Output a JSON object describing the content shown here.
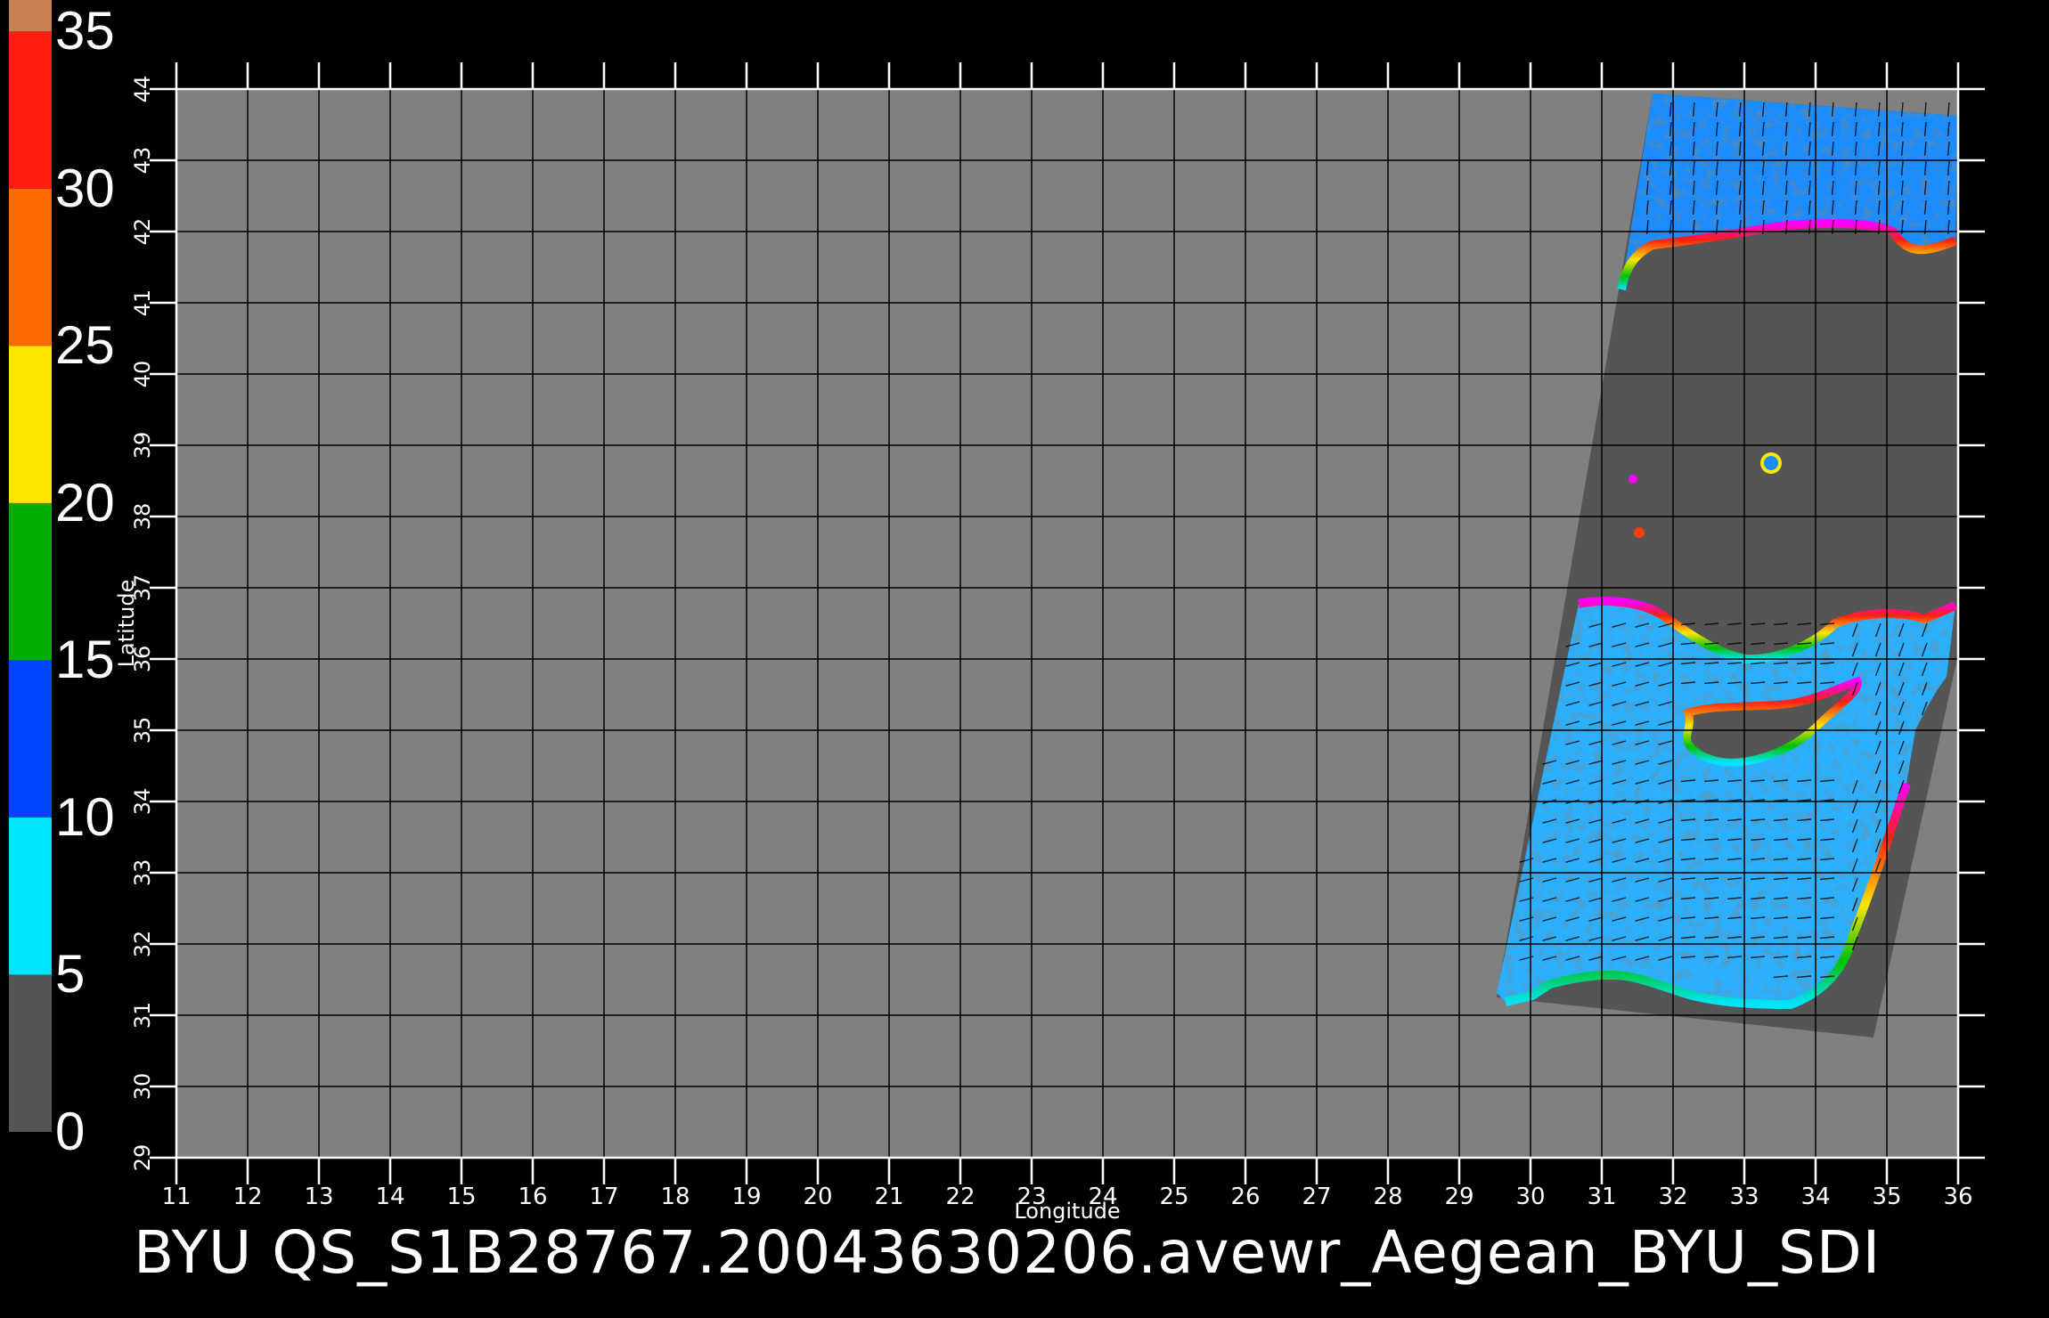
{
  "title": "BYU  QS_S1B28767.20043630206.avewr_Aegean_BYU_SDI",
  "colorbar": {
    "labels": [
      "35",
      "30",
      "25",
      "20",
      "15",
      "10",
      "5",
      "0"
    ],
    "segments": [
      {
        "from": 0,
        "to": 5,
        "color": "#555555"
      },
      {
        "from": 5,
        "to": 10,
        "color": "#00e5ff"
      },
      {
        "from": 10,
        "to": 15,
        "color": "#0044ff"
      },
      {
        "from": 15,
        "to": 20,
        "color": "#00b000"
      },
      {
        "from": 20,
        "to": 25,
        "color": "#ffe600"
      },
      {
        "from": 25,
        "to": 30,
        "color": "#ff6a00"
      },
      {
        "from": 30,
        "to": 35,
        "color": "#ff1e10"
      },
      {
        "from": 35,
        "to": 36,
        "color": "#c98050"
      }
    ]
  },
  "map": {
    "xlabel": "Longitude",
    "ylabel": "Latitude",
    "lon_ticks": [
      "11",
      "12",
      "13",
      "14",
      "15",
      "16",
      "17",
      "18",
      "19",
      "20",
      "21",
      "22",
      "23",
      "24",
      "25",
      "26",
      "27",
      "28",
      "29",
      "30",
      "31",
      "32",
      "33",
      "34",
      "35",
      "36"
    ],
    "lat_ticks": [
      "29",
      "30",
      "31",
      "32",
      "33",
      "34",
      "35",
      "36",
      "37",
      "38",
      "39",
      "40",
      "41",
      "42",
      "43",
      "44"
    ],
    "background_color": "#808080",
    "swath_color": "#555555",
    "ocean_color": "#1aa0ff"
  }
}
